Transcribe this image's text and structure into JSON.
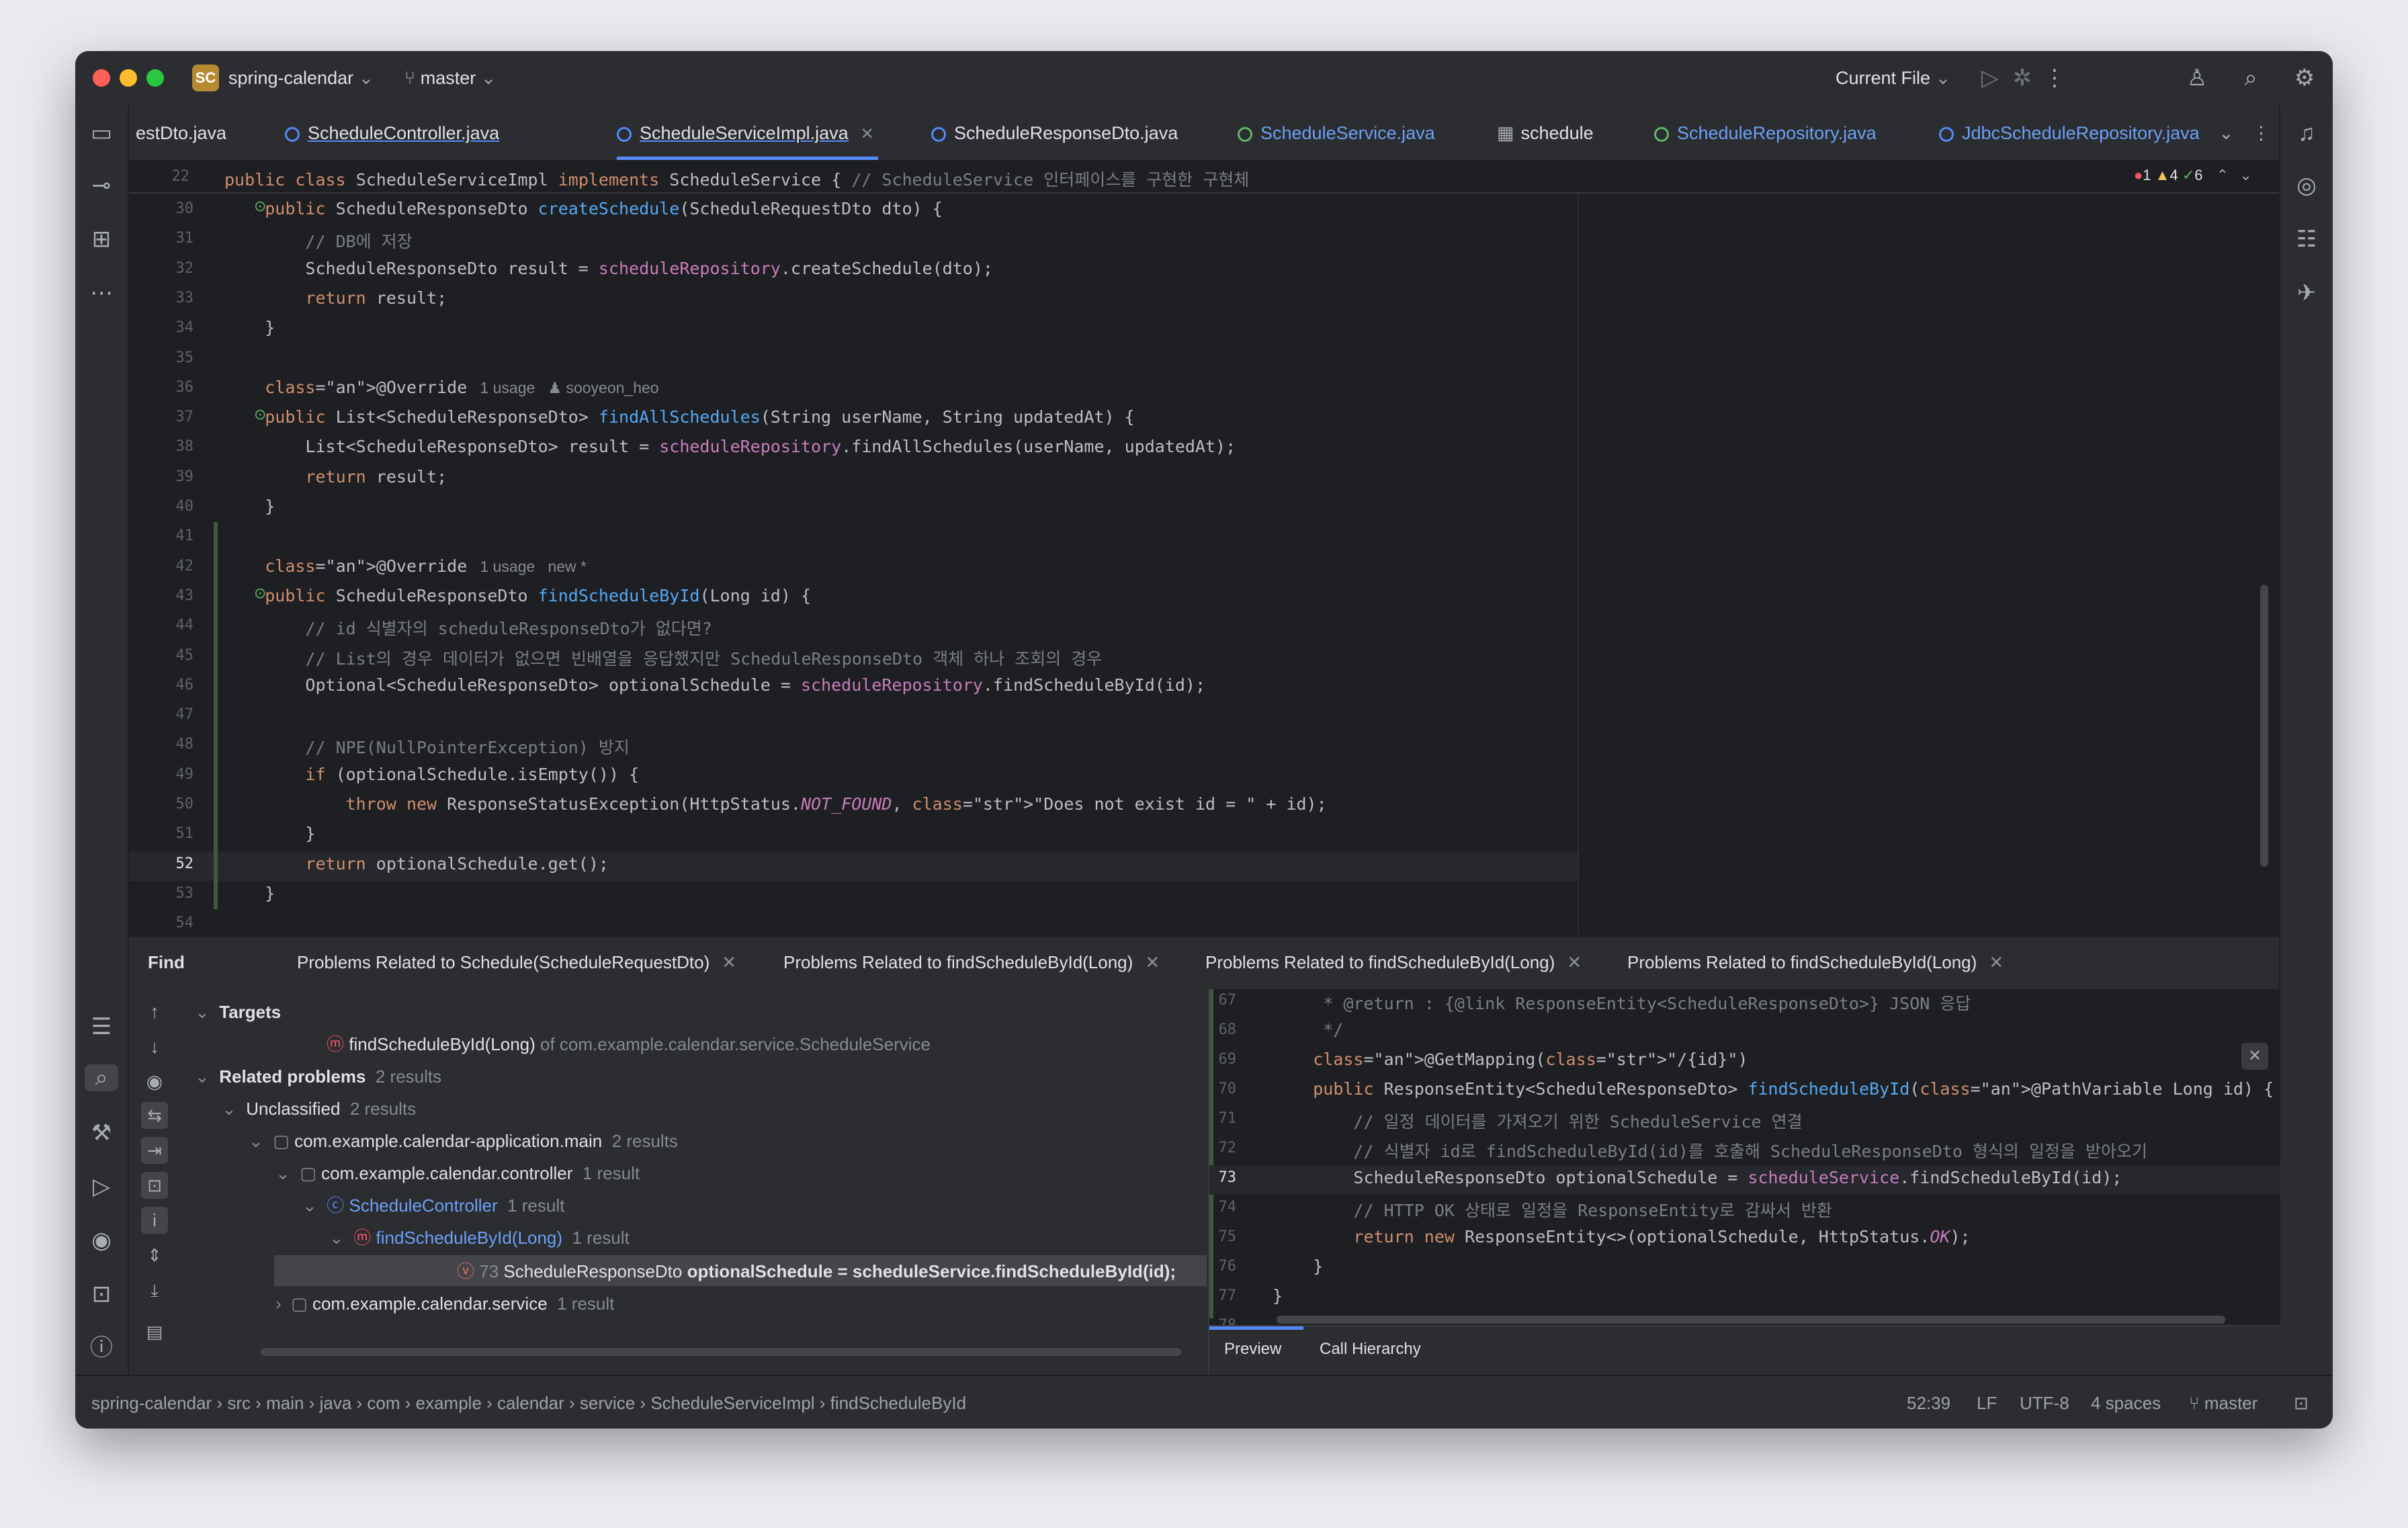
{
  "titlebar": {
    "project_badge": "SC",
    "project_name": "spring-calendar",
    "branch": "master",
    "run_config": "Current File"
  },
  "tabs": [
    {
      "label": "estDto.java"
    },
    {
      "label": "ScheduleController.java"
    },
    {
      "label": "ScheduleServiceImpl.java",
      "active": true
    },
    {
      "label": "ScheduleResponseDto.java"
    },
    {
      "label": "ScheduleService.java"
    },
    {
      "label": "schedule"
    },
    {
      "label": "ScheduleRepository.java"
    },
    {
      "label": "JdbcScheduleRepository.java"
    }
  ],
  "inspection": {
    "errors": "1",
    "warnings": "4",
    "ok": "6"
  },
  "editor": {
    "sticky_line_no": "22",
    "sticky_code": "public class ScheduleServiceImpl implements ScheduleService { // ScheduleService 인터페이스를 구현한 구현체",
    "lines": [
      {
        "n": "30",
        "t": "    public ScheduleResponseDto createSchedule(ScheduleRequestDto dto) {"
      },
      {
        "n": "31",
        "t": "        // DB에 저장"
      },
      {
        "n": "32",
        "t": "        ScheduleResponseDto result = scheduleRepository.createSchedule(dto);"
      },
      {
        "n": "33",
        "t": "        return result;"
      },
      {
        "n": "34",
        "t": "    }"
      },
      {
        "n": "35",
        "t": ""
      },
      {
        "n": "36",
        "t": "    @Override",
        "hint": "1 usage   ♟ sooyeon_heo"
      },
      {
        "n": "37",
        "t": "    public List<ScheduleResponseDto> findAllSchedules(String userName, String updatedAt) {"
      },
      {
        "n": "38",
        "t": "        List<ScheduleResponseDto> result = scheduleRepository.findAllSchedules(userName, updatedAt);"
      },
      {
        "n": "39",
        "t": "        return result;"
      },
      {
        "n": "40",
        "t": "    }"
      },
      {
        "n": "41",
        "t": ""
      },
      {
        "n": "42",
        "t": "    @Override",
        "hint": "1 usage   new *"
      },
      {
        "n": "43",
        "t": "    public ScheduleResponseDto findScheduleById(Long id) {"
      },
      {
        "n": "44",
        "t": "        // id 식별자의 scheduleResponseDto가 없다면?"
      },
      {
        "n": "45",
        "t": "        // List의 경우 데이터가 없으면 빈배열을 응답했지만 ScheduleResponseDto 객체 하나 조회의 경우"
      },
      {
        "n": "46",
        "t": "        Optional<ScheduleResponseDto> optionalSchedule = scheduleRepository.findScheduleById(id);"
      },
      {
        "n": "47",
        "t": ""
      },
      {
        "n": "48",
        "t": "        // NPE(NullPointerException) 방지"
      },
      {
        "n": "49",
        "t": "        if (optionalSchedule.isEmpty()) {"
      },
      {
        "n": "50",
        "t": "            throw new ResponseStatusException(HttpStatus.NOT_FOUND, \"Does not exist id = \" + id);"
      },
      {
        "n": "51",
        "t": "        }"
      },
      {
        "n": "52",
        "t": "        return optionalSchedule.get();"
      },
      {
        "n": "53",
        "t": "    }"
      },
      {
        "n": "54",
        "t": ""
      }
    ]
  },
  "find_panel": {
    "title": "Find",
    "tabs": [
      "Problems Related to Schedule(ScheduleRequestDto)",
      "Problems Related to findScheduleById(Long)",
      "Problems Related to findScheduleById(Long)",
      "Problems Related to findScheduleById(Long)"
    ],
    "tree": {
      "targets_label": "Targets",
      "target_method": "findScheduleById(Long)",
      "target_of": "of com.example.calendar.service.ScheduleService",
      "related_label": "Related problems",
      "related_count": "2 results",
      "unclassified_label": "Unclassified",
      "unclassified_count": "2 results",
      "module_label": "com.example.calendar-application.main",
      "module_count": "2 results",
      "controller_pkg": "com.example.calendar.controller",
      "controller_pkg_count": "1 result",
      "controller_class": "ScheduleController",
      "controller_class_count": "1 result",
      "method_label": "findScheduleById(Long)",
      "method_count": "1 result",
      "usage_line_no": "73",
      "usage_prefix": "ScheduleResponseDto ",
      "usage_bold": "optionalSchedule = scheduleService.findScheduleById(id);",
      "service_pkg": "com.example.calendar.service",
      "service_pkg_count": "1 result"
    },
    "preview": {
      "lines": [
        {
          "n": "67",
          "t": "     * @return : {@link ResponseEntity<ScheduleResponseDto>} JSON 응답"
        },
        {
          "n": "68",
          "t": "     */"
        },
        {
          "n": "69",
          "t": "    @GetMapping(\"/{id}\")"
        },
        {
          "n": "70",
          "t": "    public ResponseEntity<ScheduleResponseDto> findScheduleById(@PathVariable Long id) {"
        },
        {
          "n": "71",
          "t": "        // 일정 데이터를 가져오기 위한 ScheduleService 연결"
        },
        {
          "n": "72",
          "t": "        // 식별자 id로 findScheduleById(id)를 호출해 ScheduleResponseDto 형식의 일정을 받아오기"
        },
        {
          "n": "73",
          "t": "        ScheduleResponseDto optionalSchedule = scheduleService.findScheduleById(id);"
        },
        {
          "n": "74",
          "t": "        // HTTP OK 상태로 일정을 ResponseEntity로 감싸서 반환"
        },
        {
          "n": "75",
          "t": "        return new ResponseEntity<>(optionalSchedule, HttpStatus.OK);"
        },
        {
          "n": "76",
          "t": "    }"
        },
        {
          "n": "77",
          "t": "}"
        },
        {
          "n": "78",
          "t": ""
        }
      ],
      "bottom_tabs": [
        "Preview",
        "Call Hierarchy"
      ]
    }
  },
  "statusbar": {
    "breadcrumb": [
      "spring-calendar",
      "src",
      "main",
      "java",
      "com",
      "example",
      "calendar",
      "service",
      "ScheduleServiceImpl",
      "findScheduleById"
    ],
    "position": "52:39",
    "line_sep": "LF",
    "encoding": "UTF-8",
    "indent": "4 spaces",
    "branch": "master"
  }
}
